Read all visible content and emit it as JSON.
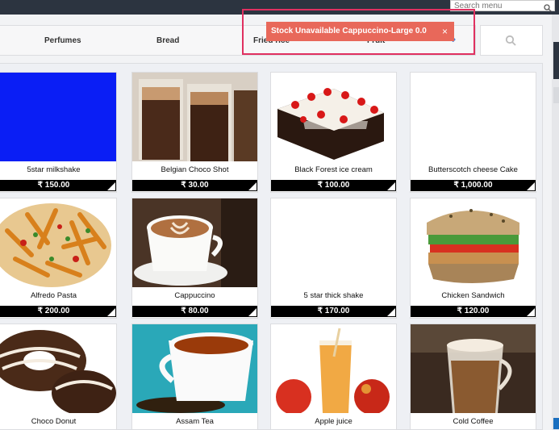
{
  "header": {
    "search_placeholder": "Search menu"
  },
  "categories": [
    "Perfumes",
    "Bread",
    "Fried rice",
    "Fruit"
  ],
  "toast": {
    "message": "Stock Unavailable Cappuccino-Large 0.0",
    "close": "×"
  },
  "products": [
    {
      "name": "5star milkshake",
      "price": "₹ 150.00"
    },
    {
      "name": "Belgian Choco Shot",
      "price": "₹ 30.00"
    },
    {
      "name": "Black Forest ice cream",
      "price": "₹ 100.00"
    },
    {
      "name": "Butterscotch cheese Cake",
      "price": "₹ 1,000.00"
    },
    {
      "name": "Alfredo Pasta",
      "price": "₹ 200.00"
    },
    {
      "name": "Cappuccino",
      "price": "₹ 80.00"
    },
    {
      "name": "5 star thick shake",
      "price": "₹ 170.00"
    },
    {
      "name": "Chicken Sandwich",
      "price": "₹ 120.00"
    },
    {
      "name": "Choco Donut",
      "price": ""
    },
    {
      "name": "Assam Tea",
      "price": ""
    },
    {
      "name": "Apple juice",
      "price": ""
    },
    {
      "name": "Cold Coffee",
      "price": ""
    }
  ]
}
